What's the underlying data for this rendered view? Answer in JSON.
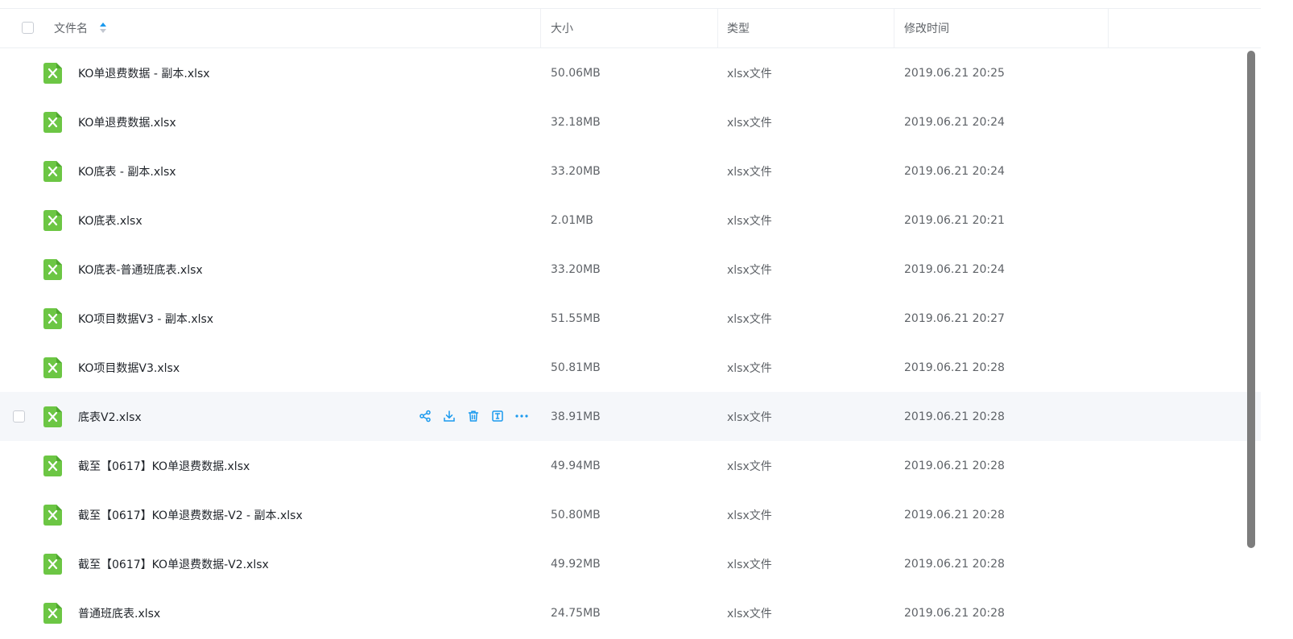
{
  "header": {
    "name_label": "文件名",
    "size_label": "大小",
    "type_label": "类型",
    "time_label": "修改时间"
  },
  "colors": {
    "accent": "#1b9aee",
    "file_icon": "#6cc644",
    "hover_row": "#f5f7fa"
  },
  "files": [
    {
      "name": "KO单退费数据 - 副本.xlsx",
      "size": "50.06MB",
      "type": "xlsx文件",
      "modified": "2019.06.21 20:25"
    },
    {
      "name": "KO单退费数据.xlsx",
      "size": "32.18MB",
      "type": "xlsx文件",
      "modified": "2019.06.21 20:24"
    },
    {
      "name": "KO底表 - 副本.xlsx",
      "size": "33.20MB",
      "type": "xlsx文件",
      "modified": "2019.06.21 20:24"
    },
    {
      "name": "KO底表.xlsx",
      "size": "2.01MB",
      "type": "xlsx文件",
      "modified": "2019.06.21 20:21"
    },
    {
      "name": "KO底表-普通班底表.xlsx",
      "size": "33.20MB",
      "type": "xlsx文件",
      "modified": "2019.06.21 20:24"
    },
    {
      "name": "KO项目数据V3 - 副本.xlsx",
      "size": "51.55MB",
      "type": "xlsx文件",
      "modified": "2019.06.21 20:27"
    },
    {
      "name": "KO项目数据V3.xlsx",
      "size": "50.81MB",
      "type": "xlsx文件",
      "modified": "2019.06.21 20:28"
    },
    {
      "name": "底表V2.xlsx",
      "size": "38.91MB",
      "type": "xlsx文件",
      "modified": "2019.06.21 20:28"
    },
    {
      "name": "截至【0617】KO单退费数据.xlsx",
      "size": "49.94MB",
      "type": "xlsx文件",
      "modified": "2019.06.21 20:28"
    },
    {
      "name": "截至【0617】KO单退费数据-V2 - 副本.xlsx",
      "size": "50.80MB",
      "type": "xlsx文件",
      "modified": "2019.06.21 20:28"
    },
    {
      "name": "截至【0617】KO单退费数据-V2.xlsx",
      "size": "49.92MB",
      "type": "xlsx文件",
      "modified": "2019.06.21 20:28"
    },
    {
      "name": "普通班底表.xlsx",
      "size": "24.75MB",
      "type": "xlsx文件",
      "modified": "2019.06.21 20:28"
    }
  ],
  "row_actions": [
    "share-icon",
    "download-icon",
    "delete-icon",
    "rename-icon",
    "more-icon"
  ]
}
